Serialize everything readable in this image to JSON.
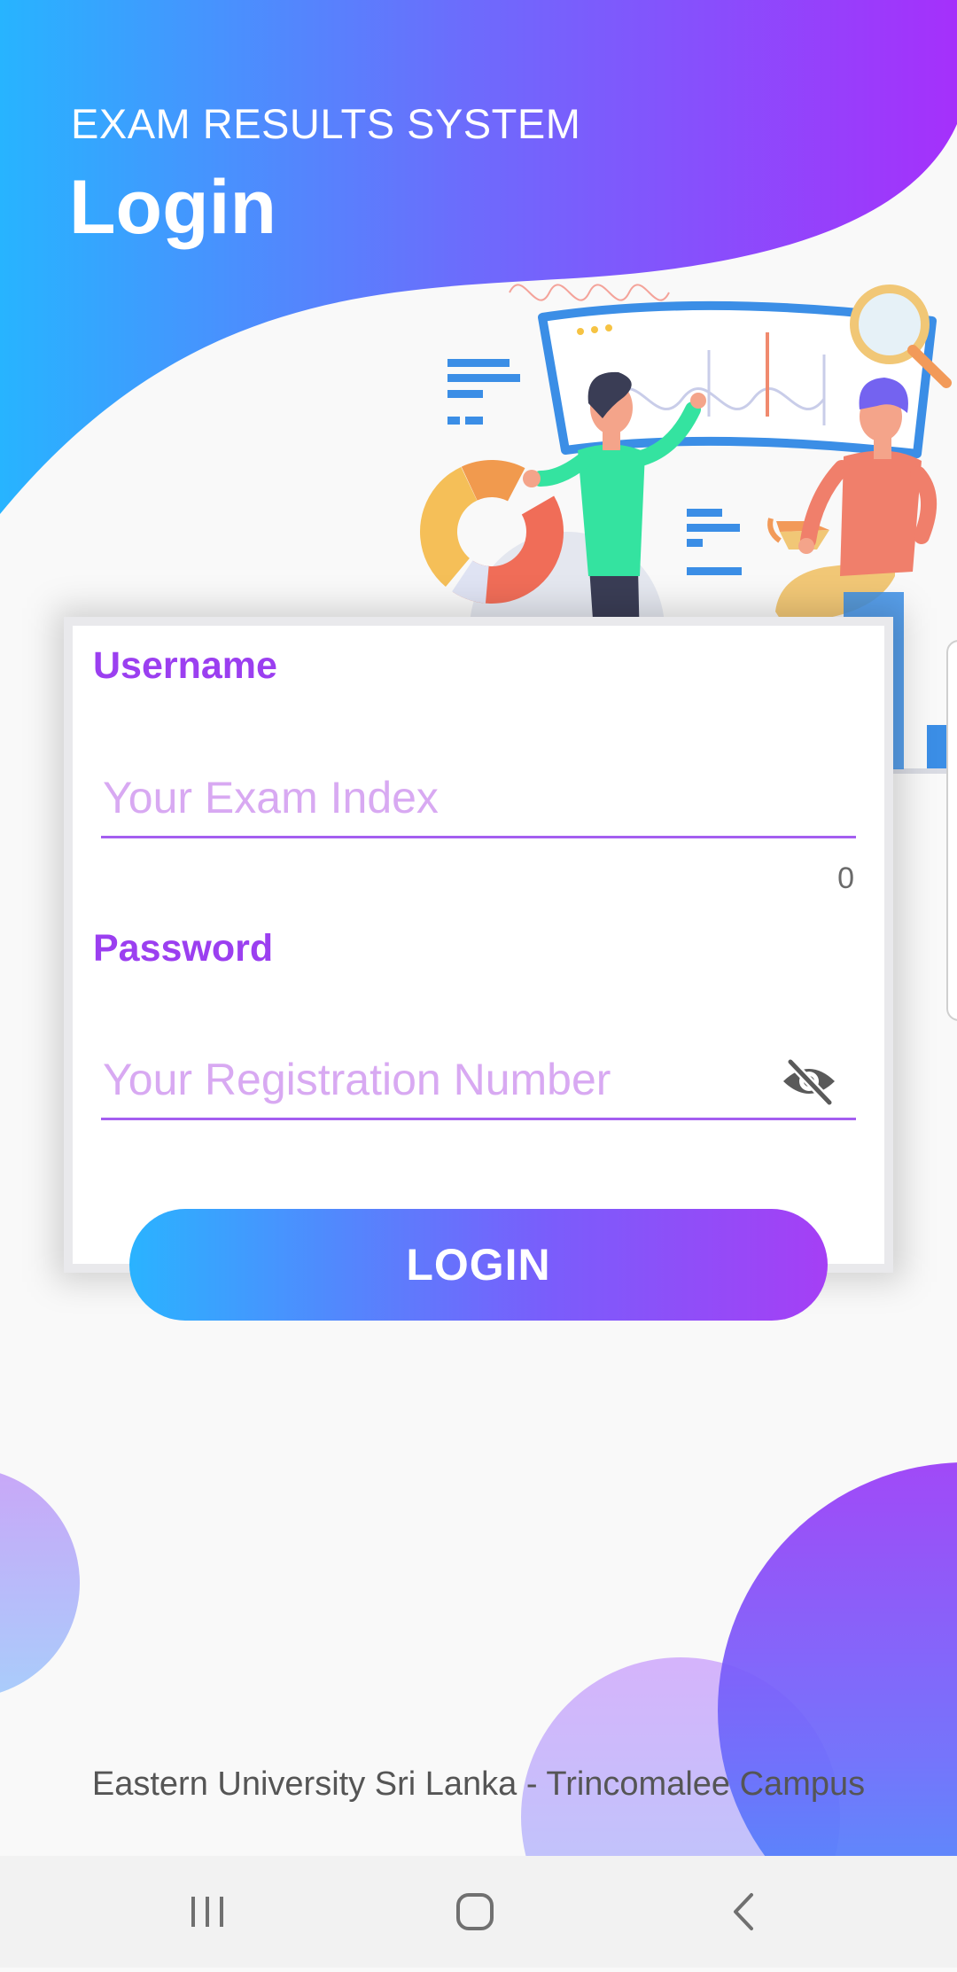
{
  "header": {
    "app_name": "EXAM RESULTS SYSTEM",
    "title": "Login"
  },
  "form": {
    "username_label": "Username",
    "username_value": "",
    "username_placeholder": "Your Exam Index",
    "username_counter": "0",
    "password_label": "Password",
    "password_value": "",
    "password_placeholder": "Your Registration Number",
    "visibility_icon": "eye-off-icon",
    "login_label": "LOGIN"
  },
  "footer": {
    "text": "Eastern University Sri Lanka - Trincomalee Campus"
  },
  "navbar": {
    "items": [
      "recent-apps-icon",
      "home-icon",
      "back-icon"
    ]
  },
  "colors": {
    "gradient_start": "#2ab3ff",
    "gradient_end": "#a53ff5",
    "label_purple": "#9b3ff0",
    "placeholder_purple": "#d8a9f2",
    "background": "#f9f9f9"
  }
}
